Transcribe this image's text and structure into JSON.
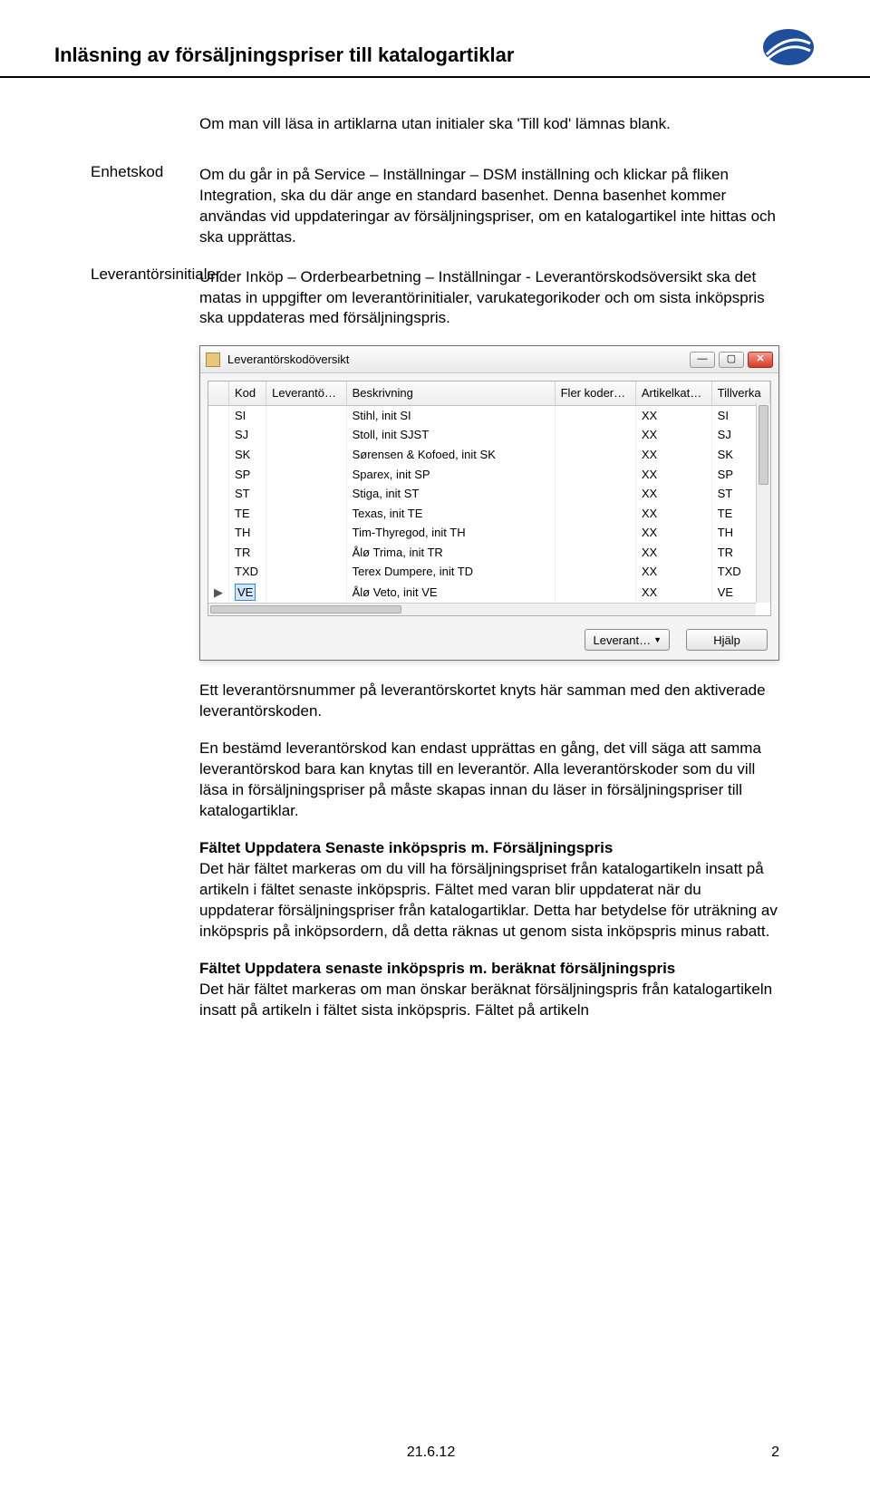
{
  "header": {
    "title": "Inläsning av försäljningspriser till katalogartiklar"
  },
  "intro": "Om man vill läsa in artiklarna utan initialer ska 'Till kod' lämnas blank.",
  "enhetskod": {
    "heading": "Enhetskod",
    "p1": "Om du går in på Service – Inställningar – DSM inställning och klickar på fliken Integration, ska du där ange en standard basenhet. Denna basenhet kommer användas vid uppdateringar av försäljningspriser, om en katalogartikel inte hittas och ska upprättas."
  },
  "leverantor": {
    "heading": "Leverantörsinitialer",
    "p1": "Under Inköp – Orderbearbetning – Inställningar - Leverantörskodsöversikt ska det matas in uppgifter om leverantörinitialer, varukategorikoder och om sista inköpspris ska uppdateras med försäljningspris."
  },
  "window": {
    "title": "Leverantörskodöversikt",
    "columns": [
      "",
      "Kod",
      "Leverantö…",
      "Beskrivning",
      "Fler koder…",
      "Artikelkat…",
      "Tillverka"
    ],
    "rows": [
      {
        "kod": "SI",
        "lev": "",
        "beskr": "Stihl, init SI",
        "fler": "",
        "art": "XX",
        "till": "SI"
      },
      {
        "kod": "SJ",
        "lev": "",
        "beskr": "Stoll, init SJST",
        "fler": "",
        "art": "XX",
        "till": "SJ"
      },
      {
        "kod": "SK",
        "lev": "",
        "beskr": "Sørensen & Kofoed, init SK",
        "fler": "",
        "art": "XX",
        "till": "SK"
      },
      {
        "kod": "SP",
        "lev": "",
        "beskr": "Sparex, init SP",
        "fler": "",
        "art": "XX",
        "till": "SP"
      },
      {
        "kod": "ST",
        "lev": "",
        "beskr": "Stiga, init ST",
        "fler": "",
        "art": "XX",
        "till": "ST"
      },
      {
        "kod": "TE",
        "lev": "",
        "beskr": "Texas, init TE",
        "fler": "",
        "art": "XX",
        "till": "TE"
      },
      {
        "kod": "TH",
        "lev": "",
        "beskr": "Tim-Thyregod, init TH",
        "fler": "",
        "art": "XX",
        "till": "TH"
      },
      {
        "kod": "TR",
        "lev": "",
        "beskr": "Ålø Trima, init TR",
        "fler": "",
        "art": "XX",
        "till": "TR"
      },
      {
        "kod": "TXD",
        "lev": "",
        "beskr": "Terex Dumpere, init TD",
        "fler": "",
        "art": "XX",
        "till": "TXD"
      },
      {
        "kod": "VE",
        "lev": "",
        "beskr": "Ålø Veto, init VE",
        "fler": "",
        "art": "XX",
        "till": "VE",
        "selected": true
      }
    ],
    "buttons": {
      "leverant": "Leverant…",
      "hjalp": "Hjälp"
    }
  },
  "after": {
    "p1": "Ett leverantörsnummer på leverantörskortet knyts här samman med den aktiverade leverantörskoden.",
    "p2": "En bestämd leverantörskod kan endast upprättas en gång, det vill säga att samma leverantörskod bara kan knytas till en leverantör. Alla leverantörskoder som du vill läsa in försäljningspriser på måste skapas innan du läser in försäljningspriser till katalogartiklar.",
    "h1": "Fältet Uppdatera Senaste inköpspris m. Försäljningspris",
    "p3": "Det här fältet markeras om du vill ha försäljningspriset från katalogartikeln insatt på artikeln i fältet senaste inköpspris. Fältet med varan blir uppdaterat när du uppdaterar försäljningspriser från katalogartiklar. Detta har betydelse för uträkning av inköpspris på inköpsordern, då detta räknas ut genom sista inköpspris minus rabatt.",
    "h2": "Fältet Uppdatera senaste inköpspris m. beräknat försäljningspris",
    "p4": "Det här fältet markeras om man önskar beräknat försäljningspris från katalogartikeln insatt på artikeln i fältet sista inköpspris. Fältet på artikeln"
  },
  "footer": {
    "date": "21.6.12",
    "page": "2"
  }
}
